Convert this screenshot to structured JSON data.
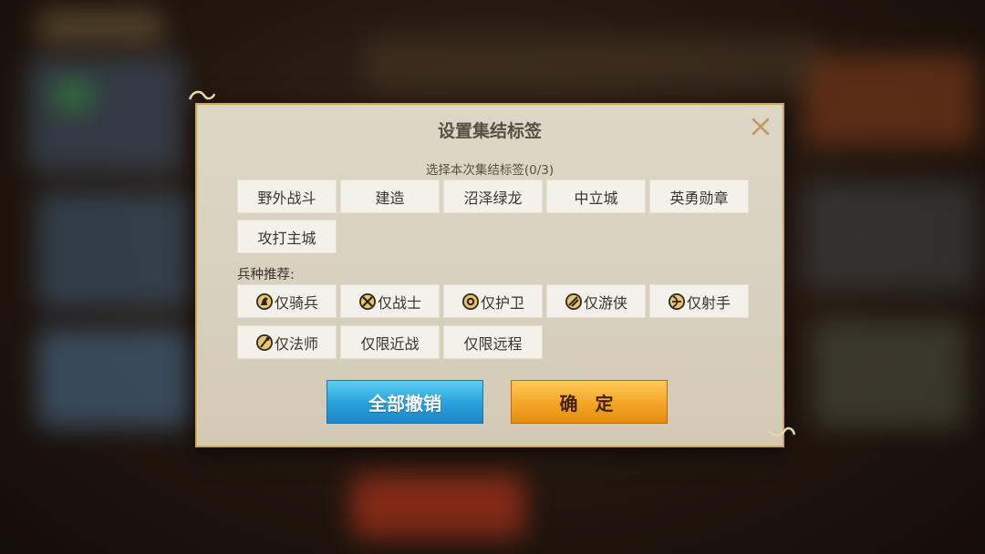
{
  "dialog": {
    "title": "设置集结标签",
    "subtitle": "选择本次集结标签(0/3)",
    "tags": [
      {
        "label": "野外战斗"
      },
      {
        "label": "建造"
      },
      {
        "label": "沼泽绿龙"
      },
      {
        "label": "中立城"
      },
      {
        "label": "英勇勋章"
      },
      {
        "label": "攻打主城"
      }
    ],
    "troop_label": "兵种推荐:",
    "troop_tags": [
      {
        "label": "仅骑兵",
        "icon": "cavalry-icon"
      },
      {
        "label": "仅战士",
        "icon": "warrior-icon"
      },
      {
        "label": "仅护卫",
        "icon": "guard-icon"
      },
      {
        "label": "仅游侠",
        "icon": "ranger-icon"
      },
      {
        "label": "仅射手",
        "icon": "archer-icon"
      },
      {
        "label": "仅法师",
        "icon": "mage-icon"
      },
      {
        "label": "仅限近战",
        "icon": ""
      },
      {
        "label": "仅限远程",
        "icon": ""
      }
    ],
    "cancel_all_label": "全部撤销",
    "confirm_label": "确 定"
  },
  "colors": {
    "panel": "#d8d1bf",
    "tag_bg": "#f4f1ea",
    "cancel_button": "#2aa3dd",
    "confirm_button": "#f3a526",
    "border_gold": "#c8a866"
  }
}
